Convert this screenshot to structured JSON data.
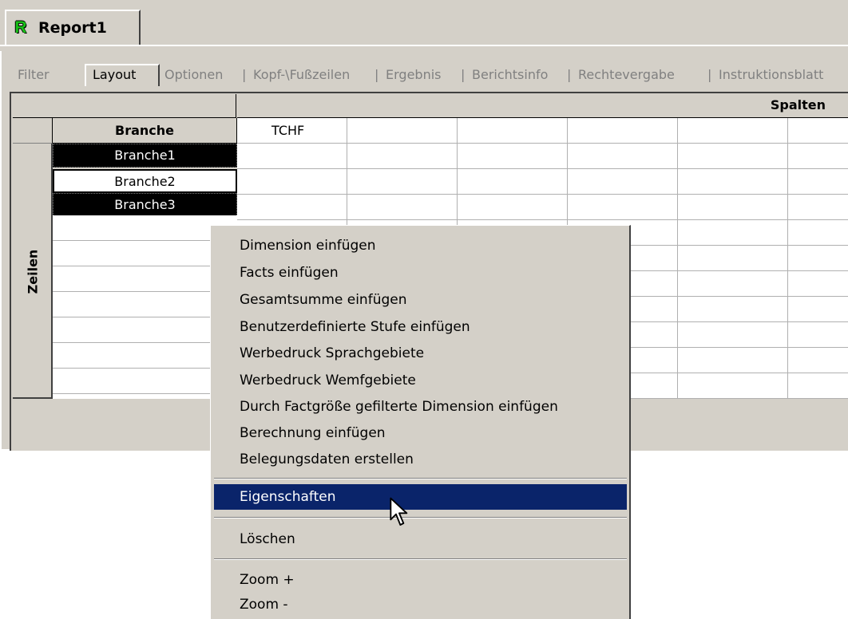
{
  "app": {
    "document_tab": "Report1",
    "icon": "r-report-icon"
  },
  "subtabs": [
    {
      "label": "Filter"
    },
    {
      "label": "Layout"
    },
    {
      "label": "Optionen"
    },
    {
      "label": "Kopf-\\Fußzeilen"
    },
    {
      "label": "Ergebnis"
    },
    {
      "label": "Berichtsinfo"
    },
    {
      "label": "Rechtevergabe"
    },
    {
      "label": "Instruktionsblatt"
    }
  ],
  "subtab_separator": "|",
  "grid": {
    "columns_header": "Spalten",
    "rows_header": "Zeilen",
    "row_dimension_header": "Branche",
    "column_fact": "TCHF",
    "row_items": [
      {
        "label": "Branche1"
      },
      {
        "label": "Branche2"
      },
      {
        "label": "Branche3"
      }
    ]
  },
  "context_menu": {
    "items": [
      "Dimension einfügen",
      "Facts einfügen",
      "Gesamtsumme einfügen",
      "Benutzerdefinierte Stufe einfügen",
      "Werbedruck Sprachgebiete",
      "Werbedruck Wemfgebiete",
      "Durch Factgröße gefilterte Dimension einfügen",
      "Berechnung einfügen",
      "Belegungsdaten erstellen"
    ],
    "properties": "Eigenschaften",
    "delete": "Löschen",
    "zoom_in": "Zoom +",
    "zoom_out": "Zoom -"
  },
  "colors": {
    "window": "#d4d0c8",
    "highlight": "#0a246a",
    "icon_green": "#18c018"
  }
}
